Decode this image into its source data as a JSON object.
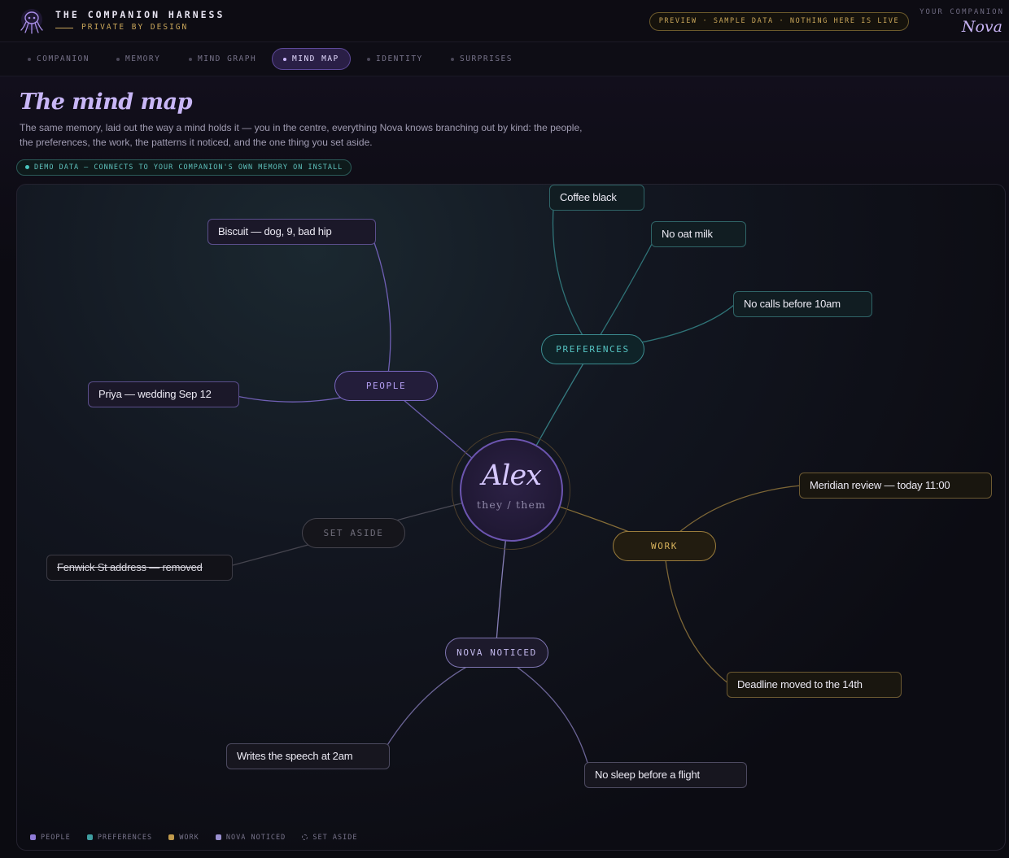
{
  "header": {
    "brand_title": "THE COMPANION HARNESS",
    "brand_subtitle": "PRIVATE BY DESIGN",
    "preview_notice": "PREVIEW · SAMPLE DATA · NOTHING HERE IS LIVE",
    "companion_label": "YOUR COMPANION",
    "companion_name": "Nova"
  },
  "nav": {
    "tabs": [
      {
        "label": "COMPANION",
        "active": false
      },
      {
        "label": "MEMORY",
        "active": false
      },
      {
        "label": "MIND GRAPH",
        "active": false
      },
      {
        "label": "MIND MAP",
        "active": true
      },
      {
        "label": "IDENTITY",
        "active": false
      },
      {
        "label": "SURPRISES",
        "active": false
      }
    ]
  },
  "page": {
    "title": "The mind map",
    "description": "The same memory, laid out the way a mind holds it — you in the centre, everything Nova knows branching out by kind: the people, the preferences, the work, the patterns it noticed, and the one thing you set aside.",
    "demo_badge": "DEMO DATA — CONNECTS TO YOUR COMPANION'S OWN MEMORY ON INSTALL"
  },
  "map": {
    "center": {
      "name": "Alex",
      "pronouns": "they / them"
    },
    "branches": {
      "people": {
        "label": "PEOPLE",
        "color": "#8f7bd6",
        "items": [
          "Biscuit — dog, 9, bad hip",
          "Priya — wedding Sep 12"
        ]
      },
      "preferences": {
        "label": "PREFERENCES",
        "color": "#3f9ea1",
        "items": [
          "Coffee black",
          "No oat milk",
          "No calls before 10am"
        ]
      },
      "work": {
        "label": "WORK",
        "color": "#c09a4c",
        "items": [
          "Meridian review — today 11:00",
          "Deadline moved to the 14th"
        ]
      },
      "noticed": {
        "label": "NOVA NOTICED",
        "color": "#9a90d0",
        "items": [
          "Writes the speech at 2am",
          "No sleep before a flight"
        ]
      },
      "aside": {
        "label": "SET ASIDE",
        "color": "#6a6872",
        "items": [
          "Fenwick St address — removed"
        ]
      }
    },
    "legend": [
      "PEOPLE",
      "PREFERENCES",
      "WORK",
      "NOVA NOTICED",
      "SET ASIDE"
    ]
  }
}
